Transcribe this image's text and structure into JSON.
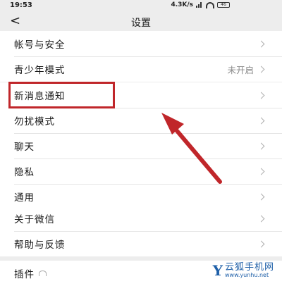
{
  "status_bar": {
    "time": "19:53",
    "speed": "4.3K/s",
    "battery": "46"
  },
  "header": {
    "title": "设置"
  },
  "groups": [
    {
      "items": [
        {
          "label": "帐号与安全",
          "value": ""
        },
        {
          "label": "青少年模式",
          "value": "未开启"
        }
      ]
    },
    {
      "items": [
        {
          "label": "新消息通知",
          "value": ""
        },
        {
          "label": "勿扰模式",
          "value": ""
        },
        {
          "label": "聊天",
          "value": ""
        },
        {
          "label": "隐私",
          "value": ""
        },
        {
          "label": "通用",
          "value": ""
        }
      ]
    },
    {
      "items": [
        {
          "label": "关于微信",
          "value": ""
        },
        {
          "label": "帮助与反馈",
          "value": ""
        }
      ]
    },
    {
      "items": [
        {
          "label": "插件",
          "value": ""
        }
      ]
    }
  ],
  "annotation": {
    "color": "#c0262a"
  },
  "watermark": {
    "logo": "Y",
    "title": "云狐手机网",
    "url": "www.yunhu.net"
  }
}
